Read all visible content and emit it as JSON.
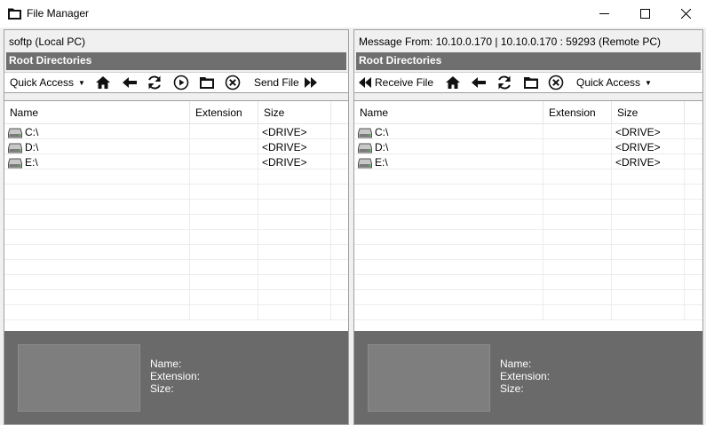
{
  "window": {
    "title": "File Manager",
    "colors": {
      "path_bar": "#6f6f6f",
      "details_bg": "#6a6a6a"
    }
  },
  "left_pane": {
    "header": "softp (Local PC)",
    "path": "Root Directories",
    "toolbar": {
      "quick_access": "Quick Access",
      "send_file": "Send File",
      "icons": [
        "home-icon",
        "back-arrow-icon",
        "refresh-icon",
        "play-icon",
        "folder-icon",
        "cancel-icon",
        "fast-forward-icon"
      ]
    },
    "columns": [
      "Name",
      "Extension",
      "Size"
    ],
    "rows": [
      {
        "name": "C:\\",
        "extension": "",
        "size": "<DRIVE>"
      },
      {
        "name": "D:\\",
        "extension": "",
        "size": "<DRIVE>"
      },
      {
        "name": "E:\\",
        "extension": "",
        "size": "<DRIVE>"
      }
    ],
    "details": {
      "name_label": "Name:",
      "extension_label": "Extension:",
      "size_label": "Size:"
    }
  },
  "right_pane": {
    "header": "Message From: 10.10.0.170 | 10.10.0.170 : 59293 (Remote PC)",
    "path": "Root Directories",
    "toolbar": {
      "receive_file": "Receive File",
      "quick_access": "Quick Access",
      "icons": [
        "rewind-icon",
        "home-icon",
        "back-arrow-icon",
        "refresh-icon",
        "folder-icon",
        "cancel-icon"
      ]
    },
    "columns": [
      "Name",
      "Extension",
      "Size"
    ],
    "rows": [
      {
        "name": "C:\\",
        "extension": "",
        "size": "<DRIVE>"
      },
      {
        "name": "D:\\",
        "extension": "",
        "size": "<DRIVE>"
      },
      {
        "name": "E:\\",
        "extension": "",
        "size": "<DRIVE>"
      }
    ],
    "details": {
      "name_label": "Name:",
      "extension_label": "Extension:",
      "size_label": "Size:"
    }
  }
}
